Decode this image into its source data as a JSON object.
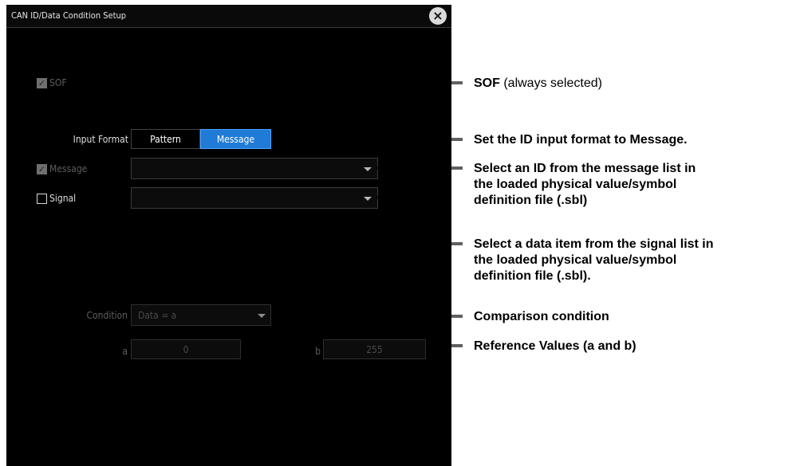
{
  "dialog": {
    "title": "CAN ID/Data Condition Setup",
    "close_symbol": "×"
  },
  "sof": {
    "label": "SOF",
    "checked": true
  },
  "input_format": {
    "label": "Input Format",
    "options": [
      "Pattern",
      "Message"
    ],
    "selected": "Message"
  },
  "message": {
    "label": "Message",
    "checked": true,
    "value": ""
  },
  "signal": {
    "label": "Signal",
    "checked": false,
    "value": ""
  },
  "condition": {
    "label": "Condition",
    "value": "Data = a"
  },
  "reference": {
    "a_label": "a",
    "a_value": "0",
    "b_label": "b",
    "b_value": "255"
  },
  "annotations": {
    "sof_bold": "SOF",
    "sof_rest": " (always selected)",
    "input_format": "Set the ID input format to Message.",
    "message_lines": [
      "Select an ID from the message list in",
      "the loaded physical value/symbol",
      "definition file (.sbl)"
    ],
    "signal_lines": [
      "Select a data item from the signal list in",
      "the loaded physical value/symbol",
      "definition file (.sbl)."
    ],
    "condition": "Comparison condition",
    "reference": "Reference Values (a and b)"
  },
  "colors": {
    "dialog_bg": "#000000",
    "accent": "#1f7bd6",
    "leader": "#000000"
  }
}
